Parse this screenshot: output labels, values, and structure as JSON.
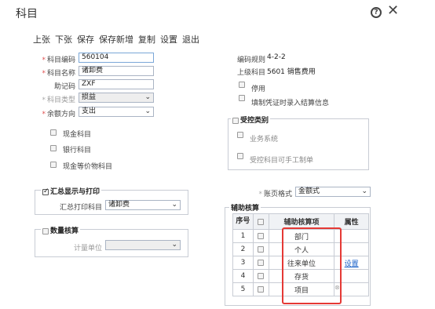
{
  "window": {
    "title": "科目"
  },
  "toolbar": [
    "上张",
    "下张",
    "保存",
    "保存新增",
    "复制",
    "设置",
    "退出"
  ],
  "form": {
    "code": {
      "label": "科目编码",
      "value": "560104"
    },
    "name": {
      "label": "科目名称",
      "value": "诸卸费"
    },
    "mnemonic": {
      "label": "助记码",
      "value": "ZXF"
    },
    "type": {
      "label": "科目类型",
      "value": "损益"
    },
    "direction": {
      "label": "余额方向",
      "value": "支出"
    }
  },
  "rules": {
    "code_rule_label": "编码规则",
    "code_rule_value": "4-2-2",
    "parent_label": "上级科目",
    "parent_value": "5601 销售费用"
  },
  "checks": {
    "disabled": "停用",
    "voucher_info": "填制凭证时录入结算信息",
    "cash": "现金科目",
    "bank": "银行科目",
    "cash_equiv": "现金等价物科目"
  },
  "control": {
    "title": "受控类别",
    "business": "业务系统",
    "manual": "受控科目可手工制单"
  },
  "summary": {
    "title": "汇总显示与打印",
    "label": "汇总打印科目",
    "value": "诸卸费"
  },
  "quantity": {
    "title": "数量核算",
    "unit_label": "计量单位"
  },
  "ledger": {
    "label": "账页格式",
    "value": "金额式"
  },
  "aux": {
    "title": "辅助核算",
    "headers": {
      "seq": "序号",
      "item": "辅助核算项",
      "attr": "属性"
    },
    "rows": [
      {
        "seq": "1",
        "item": "部门",
        "attr": ""
      },
      {
        "seq": "2",
        "item": "个人",
        "attr": ""
      },
      {
        "seq": "3",
        "item": "往来单位",
        "attr": "设置"
      },
      {
        "seq": "4",
        "item": "存货",
        "attr": ""
      },
      {
        "seq": "5",
        "item": "项目",
        "attr": ""
      }
    ]
  },
  "colors": {
    "highlight": "#e53935",
    "link": "#1a62c8"
  }
}
